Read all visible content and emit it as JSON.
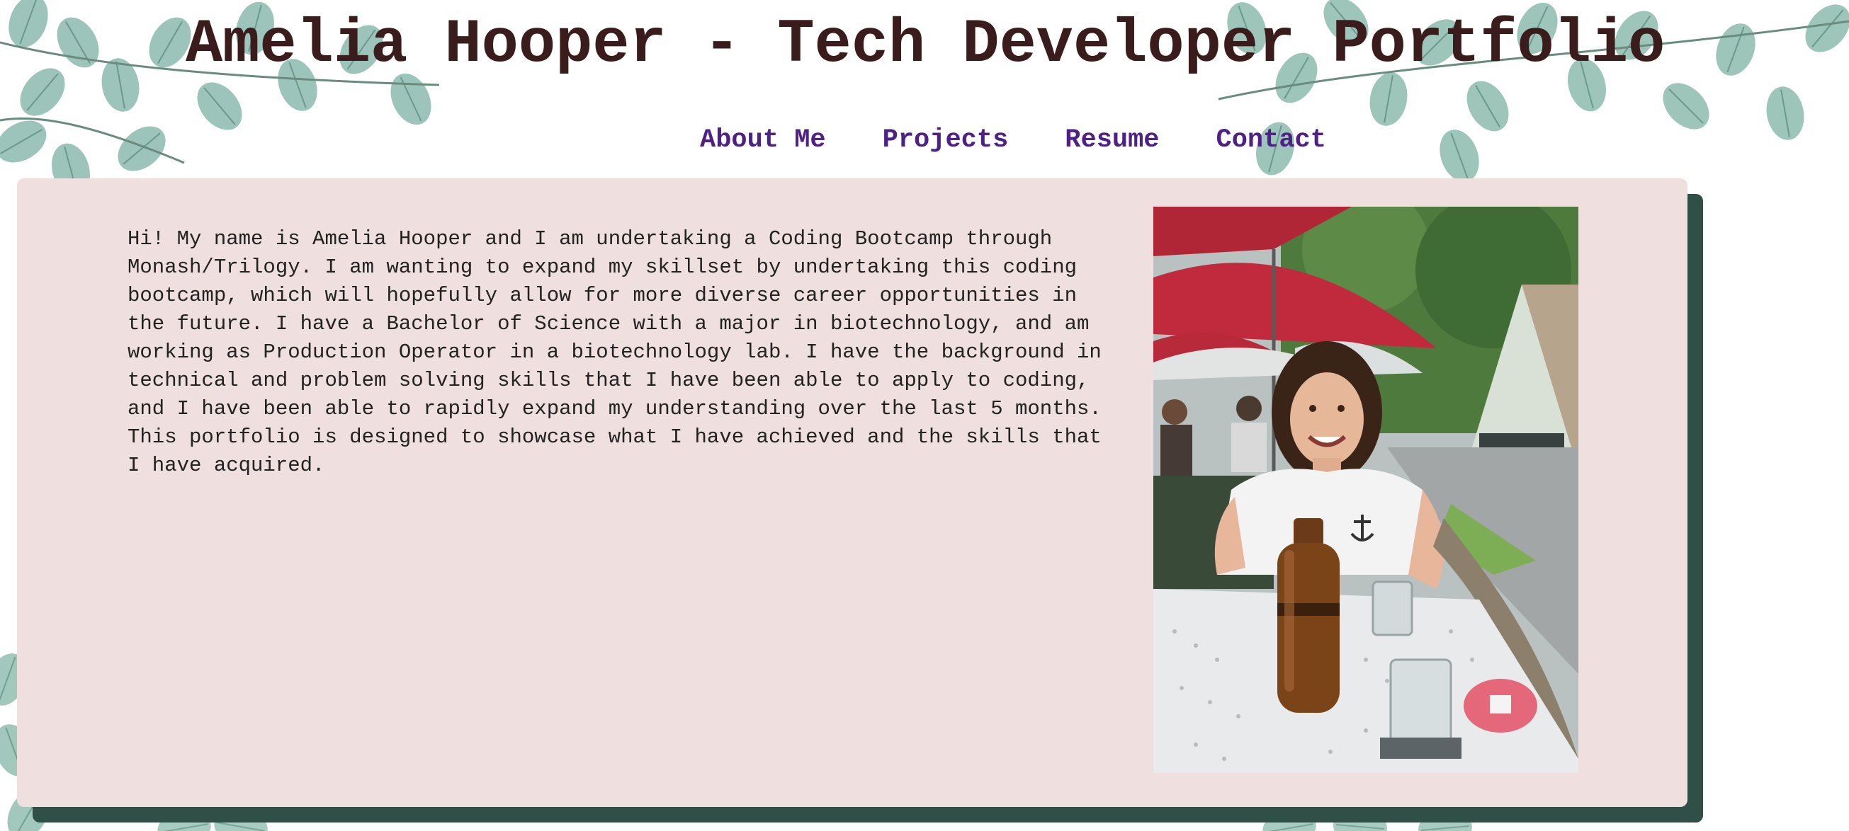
{
  "header": {
    "title": "Amelia Hooper - Tech Developer Portfolio"
  },
  "nav": {
    "items": [
      {
        "label": "About Me"
      },
      {
        "label": "Projects"
      },
      {
        "label": "Resume"
      },
      {
        "label": "Contact"
      }
    ]
  },
  "about": {
    "text": "Hi! My name is Amelia Hooper and I am undertaking a Coding Bootcamp through Monash/Trilogy. I am wanting to expand my skillset by undertaking this coding bootcamp, which will hopefully allow for more diverse career opportunities in the future. I have a Bachelor of Science with a major in biotechnology, and am working as Production Operator in a biotechnology lab. I have the background in technical and problem solving skills that I have been able to apply to coding, and I have been able to rapidly expand my understanding over the last 5 months. This portfolio is designed to showcase what I have achieved and the skills that I have acquired."
  },
  "colors": {
    "title": "#3a1c1c",
    "nav_link": "#4d2186",
    "card_background": "#efdfdf",
    "card_shadow": "#2f4f47",
    "leaf": "#6fa596"
  },
  "icons": {
    "background": "eucalyptus-leaves-icon",
    "photo": "profile-photo"
  }
}
